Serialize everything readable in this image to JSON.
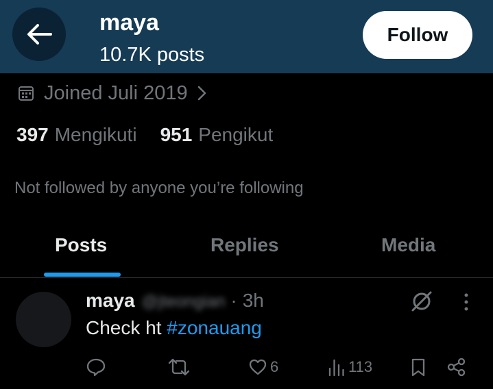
{
  "header": {
    "name": "maya",
    "posts_count": "10.7K posts",
    "follow_label": "Follow"
  },
  "profile": {
    "joined": "Joined Juli 2019",
    "following_count": "397",
    "following_label": "Mengikuti",
    "followers_count": "951",
    "followers_label": "Pengikut",
    "not_followed_text": "Not followed by anyone you’re following"
  },
  "tabs": [
    {
      "label": "Posts",
      "active": true
    },
    {
      "label": "Replies",
      "active": false
    },
    {
      "label": "Media",
      "active": false
    }
  ],
  "tweet": {
    "name": "maya",
    "handle": "@jteongian",
    "dot": "·",
    "time": "3h",
    "text_prefix": "Check ht ",
    "hashtag": "#zonauang",
    "likes": "6",
    "views": "113"
  },
  "colors": {
    "header_bg": "#163b54",
    "accent": "#1d9bf0",
    "muted": "#71767b"
  }
}
